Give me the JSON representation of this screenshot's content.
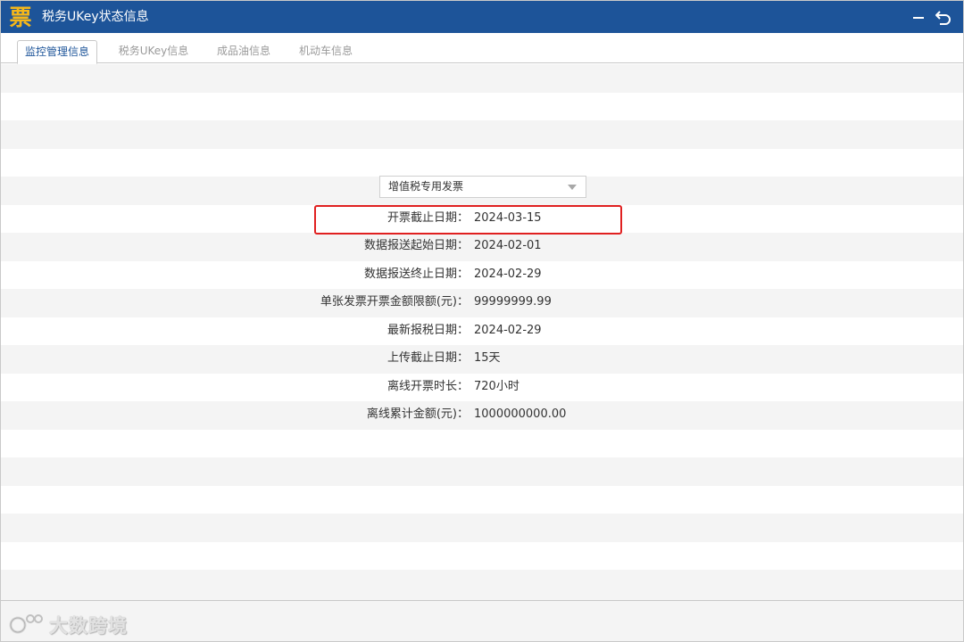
{
  "window": {
    "logo_char": "票",
    "title": "税务UKey状态信息",
    "title_color": "#1d5499",
    "logo_color": "#f5b71a"
  },
  "tabs": [
    {
      "label": "监控管理信息",
      "active": true
    },
    {
      "label": "税务UKey信息",
      "active": false
    },
    {
      "label": "成品油信息",
      "active": false
    },
    {
      "label": "机动车信息",
      "active": false
    }
  ],
  "invoice_type_select": {
    "value": "增值税专用发票"
  },
  "info": [
    {
      "label": "开票截止日期：",
      "value": "2024-03-15",
      "highlighted": true
    },
    {
      "label": "数据报送起始日期：",
      "value": "2024-02-01"
    },
    {
      "label": "数据报送终止日期：",
      "value": "2024-02-29"
    },
    {
      "label": "单张发票开票金额限额(元)：",
      "value": "99999999.99"
    },
    {
      "label": "最新报税日期：",
      "value": "2024-02-29"
    },
    {
      "label": "上传截止日期：",
      "value": "15天"
    },
    {
      "label": "离线开票时长：",
      "value": "720小时"
    },
    {
      "label": "离线累计金额(元)：",
      "value": "1000000000.00"
    }
  ],
  "highlight_color": "#e02020",
  "watermark": {
    "text": "大数跨境"
  },
  "icons": [
    "app-logo-icon",
    "minimize-icon",
    "back-icon",
    "chevron-down-icon",
    "watermark-icon"
  ]
}
